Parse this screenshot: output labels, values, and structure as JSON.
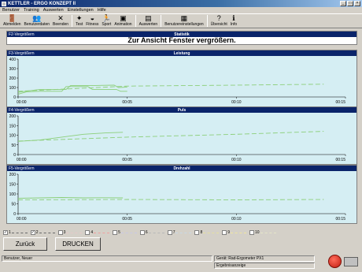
{
  "window": {
    "title": "KETTLER - ERGO KONZEPT II"
  },
  "menu": [
    "Benutzer",
    "Training",
    "Auswerten",
    "Einstellungen",
    "Hilfe"
  ],
  "toolbar": [
    {
      "label": "Abmelden",
      "icon": "exit-icon",
      "glyph": "🚪"
    },
    {
      "label": "Benutzerdaten",
      "icon": "user-data-icon",
      "glyph": "👥"
    },
    {
      "label": "Beenden",
      "icon": "close-icon",
      "glyph": "✕"
    },
    {
      "label": "Test",
      "icon": "test-icon",
      "glyph": "✦"
    },
    {
      "label": "Fitness",
      "icon": "fitness-icon",
      "glyph": "◒"
    },
    {
      "label": "Sport",
      "icon": "sport-icon",
      "glyph": "🏃"
    },
    {
      "label": "Animation",
      "icon": "animation-icon",
      "glyph": "▣"
    },
    {
      "label": "Auswerten",
      "icon": "evaluate-icon",
      "glyph": "▤"
    },
    {
      "label": "Benutzereinstellungen",
      "icon": "settings-icon",
      "glyph": "▦"
    },
    {
      "label": "Übersicht",
      "icon": "help-icon",
      "glyph": "?"
    },
    {
      "label": "Info",
      "icon": "info-icon",
      "glyph": "ℹ"
    }
  ],
  "statistik": {
    "hint": "F2-Vergrößern",
    "title": "Statistik",
    "message": "Zur Ansicht Fenster vergrößern."
  },
  "charts": [
    {
      "hint": "F3-Vergrößern",
      "title": "Leistung",
      "yticks": [
        "400",
        "300",
        "200",
        "100",
        "0"
      ],
      "xticks": [
        "00:00",
        "00:05",
        "00:10",
        "00:15"
      ]
    },
    {
      "hint": "F4-Vergrößern",
      "title": "Puls",
      "yticks": [
        "200",
        "150",
        "100",
        "50",
        "0"
      ],
      "xticks": [
        "00:00",
        "00:05",
        "00:10",
        "00:15"
      ]
    },
    {
      "hint": "F5-Vergrößern",
      "title": "Drehzahl",
      "yticks": [
        "200",
        "150",
        "100",
        "50",
        "0"
      ],
      "xticks": [
        "00:00",
        "00:05",
        "00:10",
        "00:15"
      ]
    }
  ],
  "legend": [
    {
      "num": "1",
      "checked": true,
      "color": "#6a6a6a"
    },
    {
      "num": "2",
      "checked": true,
      "color": "#6a6a6a"
    },
    {
      "num": "3",
      "checked": false,
      "color": "#e6c8c8"
    },
    {
      "num": "4",
      "checked": false,
      "color": "#f0a0a0"
    },
    {
      "num": "5",
      "checked": false,
      "color": "#c8c8e6"
    },
    {
      "num": "6",
      "checked": false,
      "color": "#b8b8b8"
    },
    {
      "num": "7",
      "checked": false,
      "color": "#c8d8e6"
    },
    {
      "num": "8",
      "checked": false,
      "color": "#e6e0a0"
    },
    {
      "num": "9",
      "checked": false,
      "color": "#f0e6a0"
    },
    {
      "num": "10",
      "checked": false,
      "color": "#e6e6c8"
    }
  ],
  "buttons": {
    "back": "Zurück",
    "print": "DRUCKEN"
  },
  "status": {
    "user": "Benutzer, Neuer",
    "device": "Gerät: Rad-Ergometer PX1",
    "view": "Ergebnisanzeige"
  },
  "logo": {
    "text": "KETTLER"
  },
  "colors": {
    "header": "#0a246a",
    "plot_bg": "#d5eef3",
    "series": "#8ccf7a"
  },
  "chart_data": [
    {
      "type": "line",
      "title": "Leistung",
      "xlabel": "",
      "ylabel": "",
      "x_unit": "min",
      "xlim": [
        0,
        15
      ],
      "ylim": [
        0,
        400
      ],
      "yticks": [
        0,
        100,
        200,
        300,
        400
      ],
      "series": [
        {
          "style": "solid",
          "x": [
            0,
            0.4,
            1,
            2,
            2.2,
            3.2,
            3.4,
            4.5,
            4.7,
            5
          ],
          "y": [
            30,
            55,
            60,
            60,
            110,
            110,
            80,
            80,
            60,
            60
          ]
        },
        {
          "style": "solid",
          "x": [
            0,
            1,
            2.2,
            2.4,
            3.3,
            4.4,
            4.6,
            5
          ],
          "y": [
            50,
            80,
            80,
            120,
            120,
            125,
            100,
            105
          ]
        },
        {
          "style": "dashed",
          "x": [
            0,
            5,
            10,
            14
          ],
          "y": [
            60,
            115,
            125,
            135
          ]
        }
      ]
    },
    {
      "type": "line",
      "title": "Puls",
      "xlabel": "",
      "ylabel": "",
      "x_unit": "min",
      "xlim": [
        0,
        15
      ],
      "ylim": [
        0,
        200
      ],
      "yticks": [
        0,
        50,
        100,
        150,
        200
      ],
      "series": [
        {
          "style": "solid",
          "x": [
            0,
            1,
            2,
            3,
            4,
            4.8
          ],
          "y": [
            68,
            75,
            90,
            105,
            112,
            115
          ]
        },
        {
          "style": "dashed",
          "x": [
            0,
            5,
            10,
            14
          ],
          "y": [
            70,
            90,
            105,
            120
          ]
        }
      ]
    },
    {
      "type": "line",
      "title": "Drehzahl",
      "xlabel": "",
      "ylabel": "",
      "x_unit": "min",
      "xlim": [
        0,
        15
      ],
      "ylim": [
        0,
        200
      ],
      "yticks": [
        0,
        50,
        100,
        150,
        200
      ],
      "series": [
        {
          "style": "solid",
          "x": [
            0,
            1,
            2,
            3,
            4,
            4.8
          ],
          "y": [
            78,
            80,
            82,
            80,
            81,
            80
          ]
        },
        {
          "style": "dashed",
          "x": [
            0,
            5,
            10,
            14
          ],
          "y": [
            70,
            72,
            70,
            72
          ]
        }
      ]
    }
  ]
}
